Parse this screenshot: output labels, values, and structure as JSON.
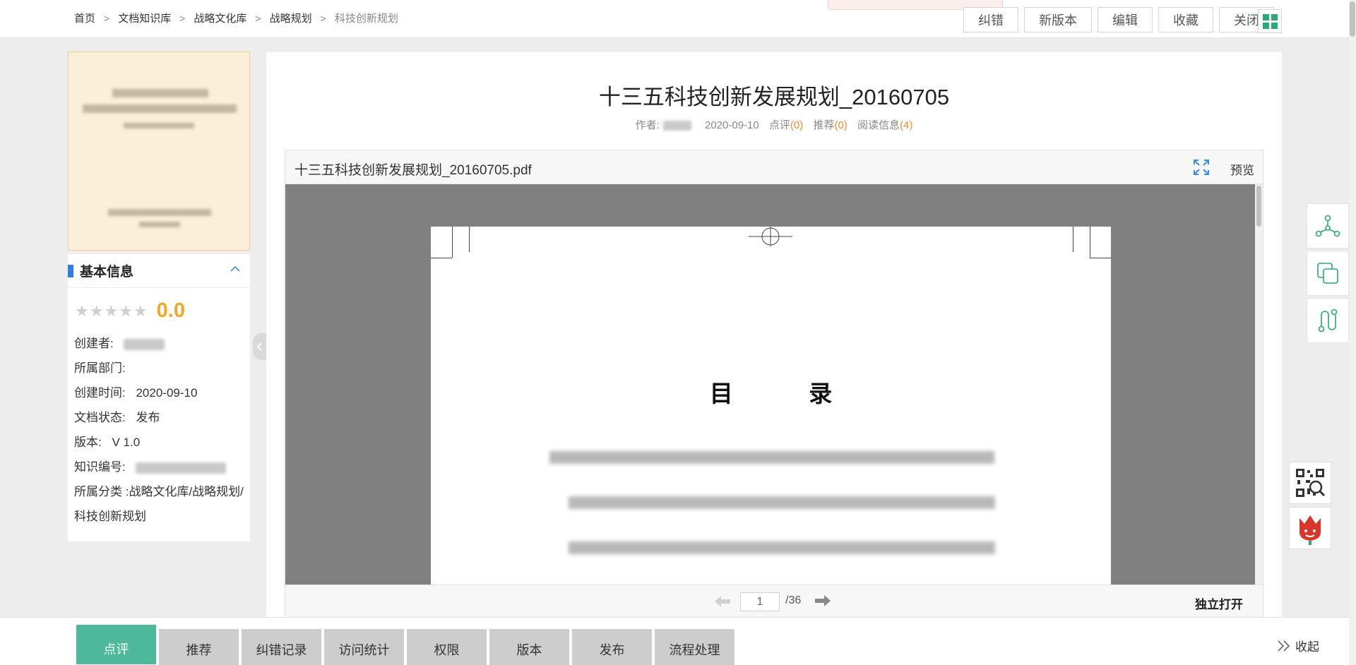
{
  "breadcrumb": {
    "items": [
      "首页",
      "文档知识库",
      "战略文化库",
      "战略规划",
      "科技创新规划"
    ],
    "separator": ">"
  },
  "toolbar": {
    "buttons": [
      "纠错",
      "新版本",
      "编辑",
      "收藏",
      "关闭"
    ],
    "grid_icon": "grid-icon"
  },
  "info": {
    "title": "基本信息",
    "score": "0.0",
    "rating_stars": 0,
    "creator_label": "创建者:",
    "dept_label": "所属部门:",
    "created_label": "创建时间:",
    "created_value": "2020-09-10",
    "status_label": "文档状态:",
    "status_value": "发布",
    "version_label": "版本:",
    "version_value": "V 1.0",
    "code_label": "知识编号:",
    "category_label": "所属分类 :",
    "category_value": "战略文化库/战略规划/科技创新规划"
  },
  "doc": {
    "title": "十三五科技创新发展规划_20160705",
    "author_label": "作者:",
    "date": "2020-09-10",
    "comment_label": "点评",
    "comment_count": "(0)",
    "recommend_label": "推荐",
    "recommend_count": "(0)",
    "read_label": "阅读信息",
    "read_count": "(4)"
  },
  "viewer": {
    "file_name": "十三五科技创新发展规划_20160705.pdf",
    "preview_label": "预览",
    "toc_title": "目 录",
    "current_page": "1",
    "total_pages": "/36",
    "open_label": "独立打开"
  },
  "bottom_tabs": [
    "点评",
    "推荐",
    "纠错记录",
    "访问统计",
    "权限",
    "版本",
    "发布",
    "流程处理"
  ],
  "collapse_label": "收起",
  "colors": {
    "accent_green": "#4db89a",
    "score_orange": "#f5a623",
    "link_orange": "#f08c2c",
    "info_bar_blue": "#2f7de1"
  }
}
